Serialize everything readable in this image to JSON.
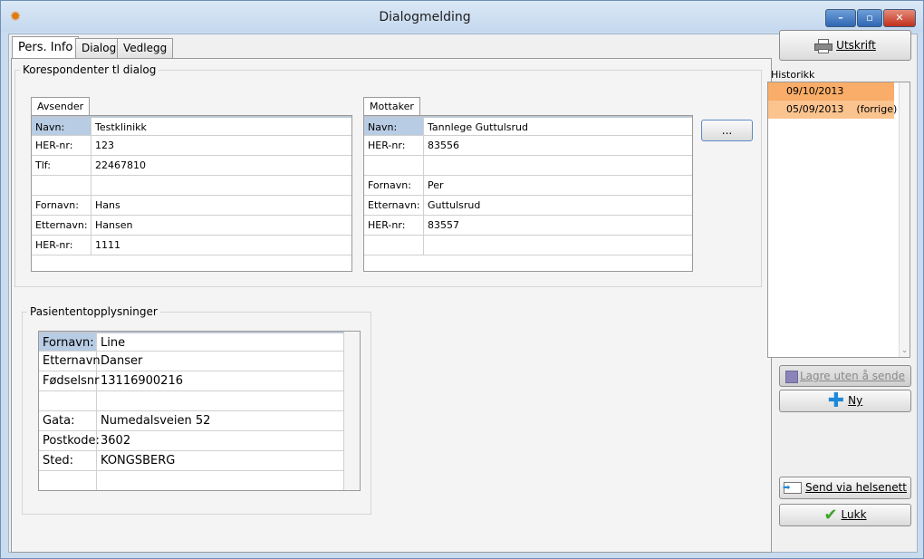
{
  "window": {
    "title": "Dialogmelding"
  },
  "tabs": [
    "Pers. Info",
    "Dialog",
    "Vedlegg"
  ],
  "korrespondenter": {
    "title": "Korespondenter tl dialog",
    "avsender": {
      "tab": "Avsender",
      "rows": [
        {
          "label": "Navn:",
          "value": "Testklinikk"
        },
        {
          "label": "HER-nr:",
          "value": "123"
        },
        {
          "label": "Tlf:",
          "value": "22467810"
        },
        {
          "label": "",
          "value": ""
        },
        {
          "label": "Fornavn:",
          "value": "Hans"
        },
        {
          "label": "Etternavn:",
          "value": "Hansen"
        },
        {
          "label": "HER-nr:",
          "value": "1111"
        }
      ]
    },
    "mottaker": {
      "tab": "Mottaker",
      "rows": [
        {
          "label": "Navn:",
          "value": "Tannlege Guttulsrud"
        },
        {
          "label": "HER-nr:",
          "value": "83556"
        },
        {
          "label": "",
          "value": ""
        },
        {
          "label": "Fornavn:",
          "value": "Per"
        },
        {
          "label": "Etternavn:",
          "value": "Guttulsrud"
        },
        {
          "label": "HER-nr:",
          "value": "83557"
        },
        {
          "label": "",
          "value": ""
        }
      ]
    },
    "browse_button": "..."
  },
  "pasient": {
    "title": "Pasiententopplysninger",
    "rows": [
      {
        "label": "Fornavn:",
        "value": "Line"
      },
      {
        "label": "Etternavn",
        "value": "Danser"
      },
      {
        "label": "Fødselsnr",
        "value": "13116900216"
      },
      {
        "label": "",
        "value": ""
      },
      {
        "label": "Gata:",
        "value": "Numedalsveien 52"
      },
      {
        "label": "Postkode:",
        "value": "3602"
      },
      {
        "label": "Sted:",
        "value": "KONGSBERG"
      },
      {
        "label": "",
        "value": ""
      }
    ]
  },
  "sidebar": {
    "utskrift": "Utskrift",
    "historikk_label": "Historikk",
    "historikk": [
      {
        "date": "09/10/2013",
        "note": ""
      },
      {
        "date": "05/09/2013",
        "note": "(forrige)"
      }
    ],
    "lagre": "Lagre uten å sende",
    "ny": "Ny",
    "send": "Send via helsenett",
    "lukk": "Lukk"
  }
}
